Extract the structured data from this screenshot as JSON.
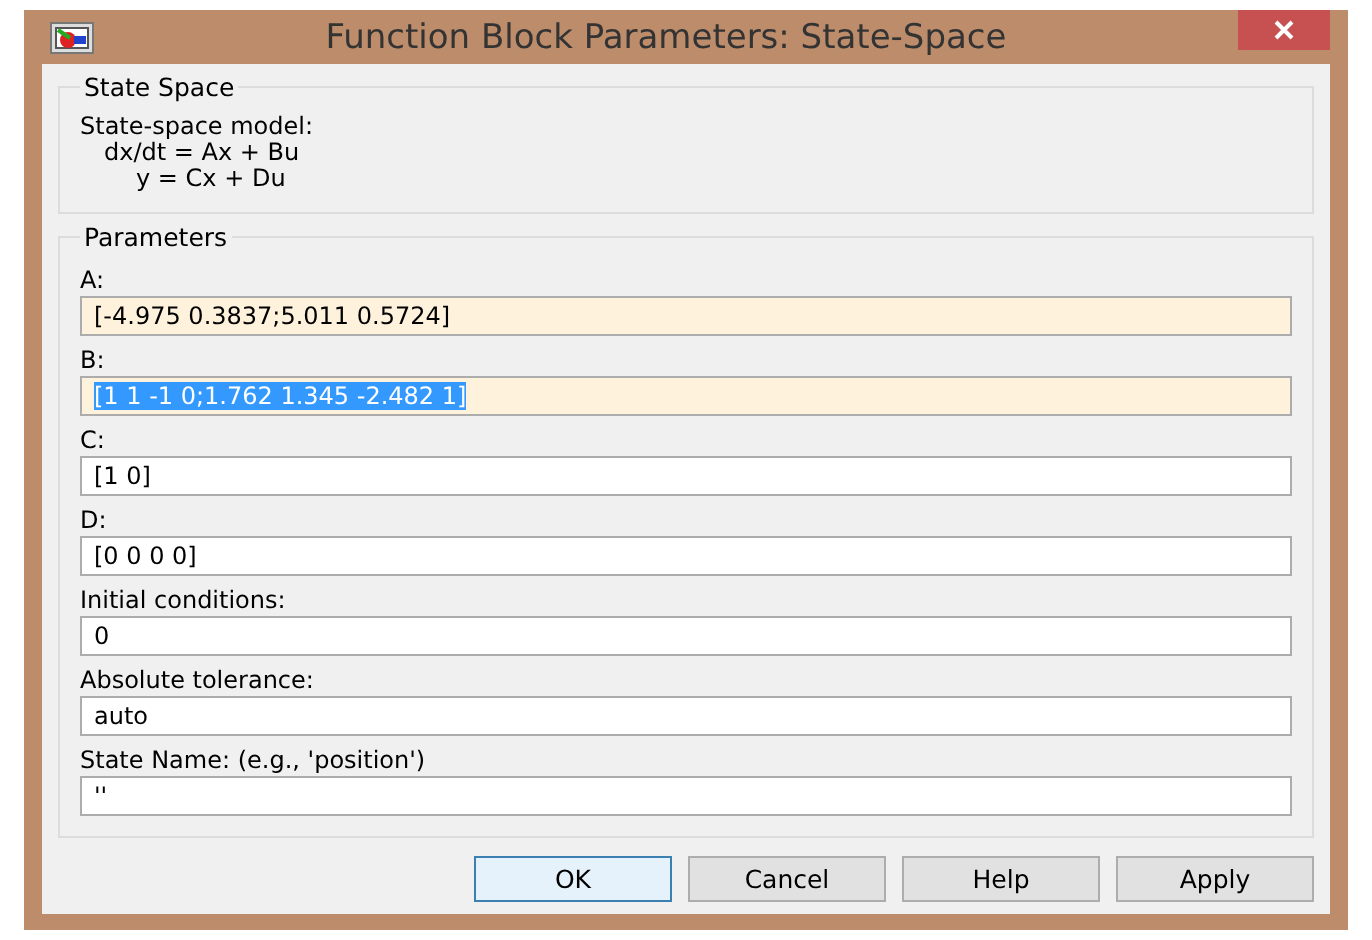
{
  "window": {
    "title": "Function Block Parameters: State-Space"
  },
  "description": {
    "heading": "State Space",
    "lines": [
      "State-space model:",
      "dx/dt = Ax + Bu",
      "y = Cx + Du"
    ]
  },
  "parameters": {
    "heading": "Parameters",
    "fields": [
      {
        "label": "A:",
        "value": "[-4.975 0.3837;5.011 0.5724]",
        "modified": true,
        "selected": false
      },
      {
        "label": "B:",
        "value": "[1 1 -1 0;1.762 1.345 -2.482 1]",
        "modified": true,
        "selected": true
      },
      {
        "label": "C:",
        "value": "[1 0]",
        "modified": false,
        "selected": false
      },
      {
        "label": "D:",
        "value": "[0 0 0 0]",
        "modified": false,
        "selected": false
      },
      {
        "label": "Initial conditions:",
        "value": "0",
        "modified": false,
        "selected": false
      },
      {
        "label": "Absolute tolerance:",
        "value": "auto",
        "modified": false,
        "selected": false
      },
      {
        "label": "State Name: (e.g., 'position')",
        "value": "''",
        "modified": false,
        "selected": false
      }
    ]
  },
  "buttons": [
    {
      "label": "OK",
      "default": true
    },
    {
      "label": "Cancel",
      "default": false
    },
    {
      "label": "Help",
      "default": false
    },
    {
      "label": "Apply",
      "default": false
    }
  ]
}
